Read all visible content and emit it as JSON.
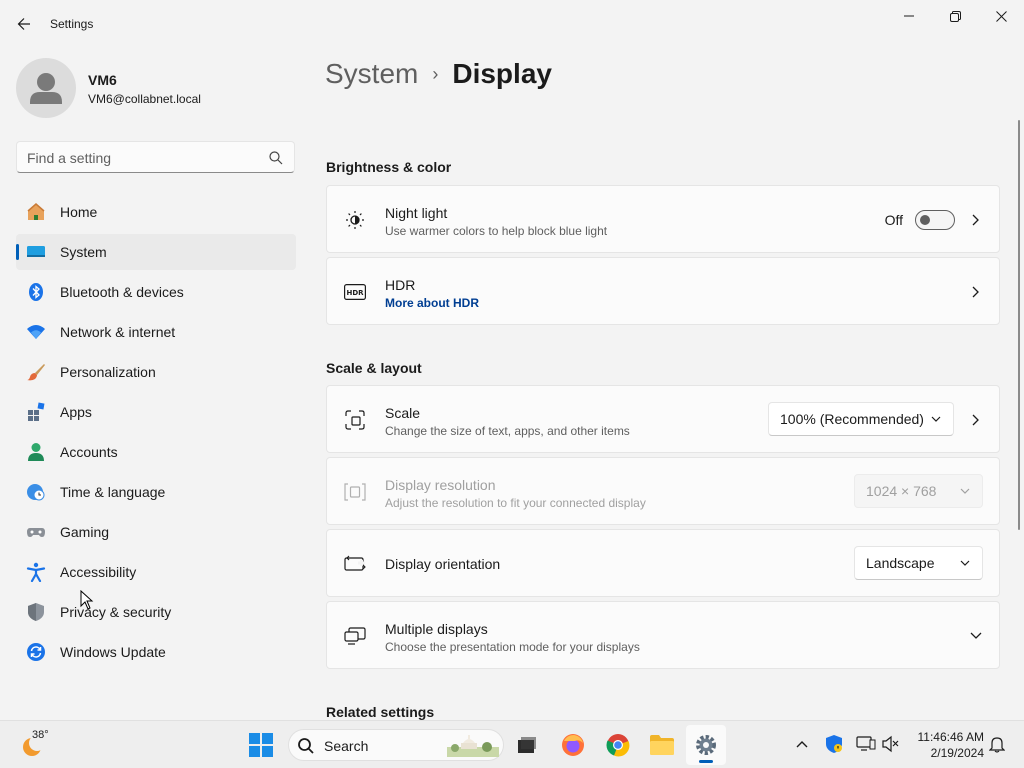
{
  "window": {
    "title": "Settings"
  },
  "user": {
    "name": "VM6",
    "email": "VM6@collabnet.local"
  },
  "search": {
    "placeholder": "Find a setting"
  },
  "nav": {
    "items": [
      {
        "label": "Home",
        "icon": "home-icon"
      },
      {
        "label": "System",
        "icon": "system-icon",
        "active": true
      },
      {
        "label": "Bluetooth & devices",
        "icon": "bluetooth-icon"
      },
      {
        "label": "Network & internet",
        "icon": "wifi-icon"
      },
      {
        "label": "Personalization",
        "icon": "brush-icon"
      },
      {
        "label": "Apps",
        "icon": "apps-icon"
      },
      {
        "label": "Accounts",
        "icon": "accounts-icon"
      },
      {
        "label": "Time & language",
        "icon": "clock-globe-icon"
      },
      {
        "label": "Gaming",
        "icon": "gamepad-icon"
      },
      {
        "label": "Accessibility",
        "icon": "accessibility-icon"
      },
      {
        "label": "Privacy & security",
        "icon": "shield-icon"
      },
      {
        "label": "Windows Update",
        "icon": "update-icon"
      }
    ]
  },
  "breadcrumb": {
    "parent": "System",
    "separator": "›",
    "current": "Display"
  },
  "sections": {
    "brightness": "Brightness & color",
    "scale_layout": "Scale & layout",
    "related": "Related settings"
  },
  "cards": {
    "night_light": {
      "title": "Night light",
      "desc": "Use warmer colors to help block blue light",
      "state": "Off"
    },
    "hdr": {
      "title": "HDR",
      "link": "More about HDR"
    },
    "scale": {
      "title": "Scale",
      "desc": "Change the size of text, apps, and other items",
      "value": "100% (Recommended)"
    },
    "resolution": {
      "title": "Display resolution",
      "desc": "Adjust the resolution to fit your connected display",
      "value": "1024 × 768"
    },
    "orientation": {
      "title": "Display orientation",
      "value": "Landscape"
    },
    "multiple": {
      "title": "Multiple displays",
      "desc": "Choose the presentation mode for your displays"
    }
  },
  "taskbar": {
    "temperature": "38°",
    "search_label": "Search",
    "time": "11:46:46 AM",
    "date": "2/19/2024"
  },
  "colors": {
    "accent": "#005fb8",
    "background": "#f3f3f3",
    "card": "#fbfbfb"
  }
}
